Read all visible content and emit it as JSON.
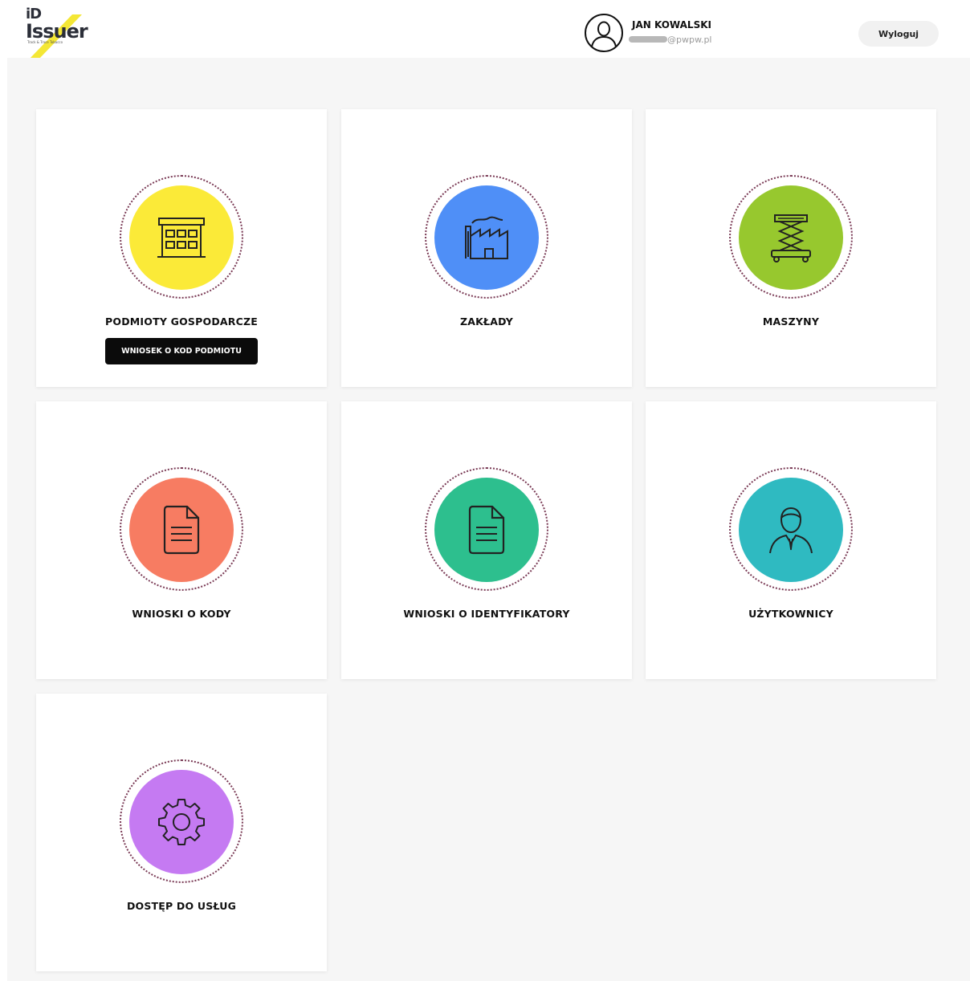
{
  "header": {
    "logo": {
      "title": "Issuer",
      "prefix": "iD",
      "tagline": "Track & Trace Tobacco"
    },
    "user": {
      "name": "JAN KOWALSKI",
      "email_domain": "@pwpw.pl"
    },
    "logout_label": "Wyloguj"
  },
  "tiles": [
    {
      "label": "PODMIOTY GOSPODARCZE",
      "icon": "building-icon",
      "color": "#fbea38",
      "button_label": "WNIOSEK O KOD PODMIOTU"
    },
    {
      "label": "ZAKŁADY",
      "icon": "factory-icon",
      "color": "#4f8ff7"
    },
    {
      "label": "MASZYNY",
      "icon": "scissor-lift-icon",
      "color": "#97c82e"
    },
    {
      "label": "WNIOSKI O KODY",
      "icon": "document-icon",
      "color": "#f77c62"
    },
    {
      "label": "WNIOSKI O IDENTYFIKATORY",
      "icon": "document-icon",
      "color": "#2dbf8e"
    },
    {
      "label": "UŻYTKOWNICY",
      "icon": "user-icon",
      "color": "#2fbac1"
    },
    {
      "label": "DOSTĘP DO USŁUG",
      "icon": "gear-icon",
      "color": "#c57af2"
    }
  ]
}
